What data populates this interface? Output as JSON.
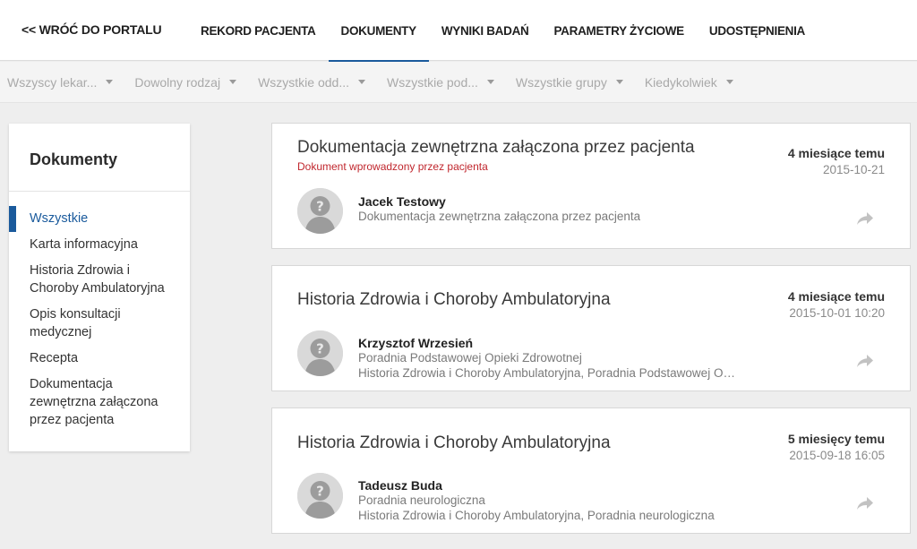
{
  "nav": {
    "back": "<< WRÓĆ DO PORTALU",
    "tabs": [
      {
        "label": "REKORD PACJENTA"
      },
      {
        "label": "DOKUMENTY"
      },
      {
        "label": "WYNIKI BADAŃ"
      },
      {
        "label": "PARAMETRY ŻYCIOWE"
      },
      {
        "label": "UDOSTĘPNIENIA"
      }
    ],
    "active_tab": "DOKUMENTY"
  },
  "filters": [
    {
      "label": "Wszyscy lekar..."
    },
    {
      "label": "Dowolny rodzaj"
    },
    {
      "label": "Wszystkie odd..."
    },
    {
      "label": "Wszystkie pod..."
    },
    {
      "label": "Wszystkie grupy"
    },
    {
      "label": "Kiedykolwiek"
    }
  ],
  "sidebar": {
    "title": "Dokumenty",
    "items": [
      {
        "label": "Wszystkie"
      },
      {
        "label": "Karta informacyjna"
      },
      {
        "label": "Historia Zdrowia i Choroby Ambulatoryjna"
      },
      {
        "label": "Opis konsultacji medycznej"
      },
      {
        "label": "Recepta"
      },
      {
        "label": "Dokumentacja zewnętrzna załączona przez pacjenta"
      }
    ],
    "active_item": "Wszystkie"
  },
  "documents": [
    {
      "title": "Dokumentacja zewnętrzna załączona przez pacjenta",
      "note": "Dokument wprowadzony przez pacjenta",
      "relative_time": "4 miesiące temu",
      "date": "2015-10-21",
      "author": "Jacek Testowy",
      "lines": [
        "Dokumentacja zewnętrzna załączona przez pacjenta"
      ]
    },
    {
      "title": "Historia Zdrowia i Choroby Ambulatoryjna",
      "note": "",
      "relative_time": "4 miesiące temu",
      "date": "2015-10-01 10:20",
      "author": "Krzysztof Wrzesień",
      "lines": [
        "Poradnia Podstawowej Opieki Zdrowotnej",
        "Historia Zdrowia i Choroby Ambulatoryjna, Poradnia Podstawowej Opi..."
      ]
    },
    {
      "title": "Historia Zdrowia i Choroby Ambulatoryjna",
      "note": "",
      "relative_time": "5 miesięcy temu",
      "date": "2015-09-18 16:05",
      "author": "Tadeusz Buda",
      "lines": [
        "Poradnia neurologiczna",
        "Historia Zdrowia i Choroby Ambulatoryjna, Poradnia neurologiczna"
      ]
    }
  ],
  "icons": {
    "avatar": "person-question-icon",
    "share": "share-arrow-icon",
    "caret": "caret-down-icon"
  },
  "colors": {
    "accent": "#1a5a9c",
    "note": "#c0262d"
  }
}
